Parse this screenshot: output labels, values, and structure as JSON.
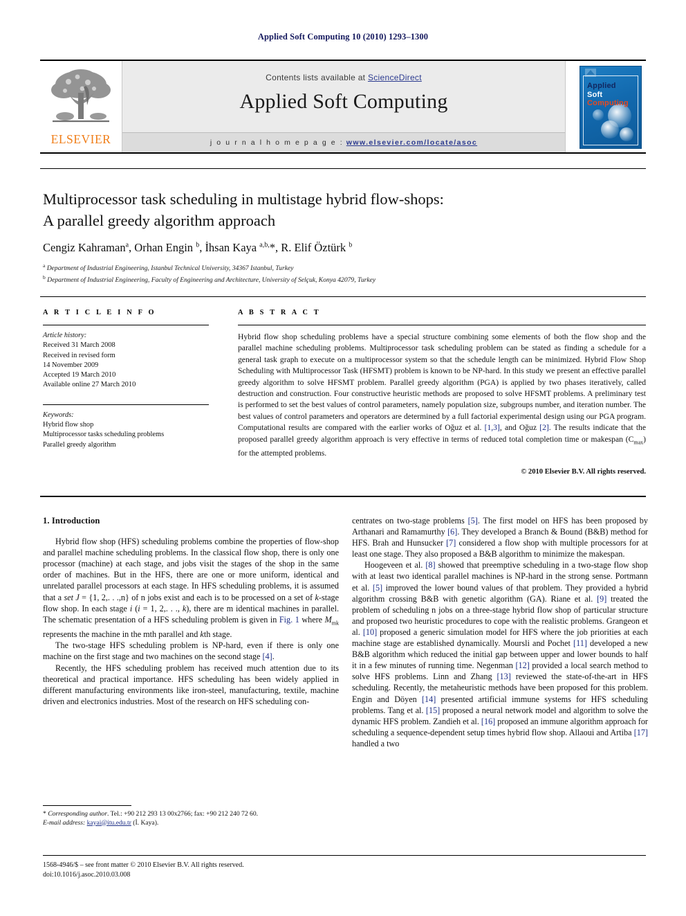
{
  "running_head": "Applied Soft Computing 10 (2010) 1293–1300",
  "masthead": {
    "contents_prefix": "Contents lists available at ",
    "sciencedirect": "ScienceDirect",
    "journal_name": "Applied Soft Computing",
    "homepage_label": "j o u r n a l    h o m e p a g e :",
    "homepage_url": "www.elsevier.com/locate/asoc",
    "publisher_wordmark": "ELSEVIER",
    "cover": {
      "line1": "Applied",
      "line2": "Soft",
      "line3": "Computing",
      "bg_color": "#1269ae",
      "line1_color": "#11265f",
      "line2_color": "#ffffff",
      "line3_color": "#e8491f"
    }
  },
  "article": {
    "title_line1": "Multiprocessor task scheduling in multistage hybrid flow-shops:",
    "title_line2": "A parallel greedy algorithm approach",
    "authors_html": "Cengiz Kahraman<sup>a</sup>, Orhan Engin <sup>b</sup>, İhsan Kaya <sup>a,b,</sup>*, R. Elif Öztürk <sup>b</sup>",
    "affiliation_a": "Department of Industrial Engineering, Istanbul Technical University, 34367 Istanbul, Turkey",
    "affiliation_b": "Department of Industrial Engineering, Faculty of Engineering and Architecture, University of Selçuk, Konya 42079, Turkey"
  },
  "info": {
    "heading": "A R T I C L E  I N F O",
    "history_label": "Article history:",
    "history": [
      "Received 31 March 2008",
      "Received in revised form",
      "14 November 2009",
      "Accepted 19 March 2010",
      "Available online 27 March 2010"
    ],
    "keywords_label": "Keywords:",
    "keywords": [
      "Hybrid flow shop",
      "Multiprocessor tasks scheduling problems",
      "Parallel greedy algorithm"
    ]
  },
  "abstract": {
    "heading": "A B S T R A C T",
    "text_html": "Hybrid flow shop scheduling problems have a special structure combining some elements of both the flow shop and the parallel machine scheduling problems. Multiprocessor task scheduling problem can be stated as finding a schedule for a general task graph to execute on a multiprocessor system so that the schedule length can be minimized. Hybrid Flow Shop Scheduling with Multiprocessor Task (HFSMT) problem is known to be NP-hard. In this study we present an effective parallel greedy algorithm to solve HFSMT problem. Parallel greedy algorithm (PGA) is applied by two phases iteratively, called destruction and construction. Four constructive heuristic methods are proposed to solve HFSMT problems. A preliminary test is performed to set the best values of control parameters, namely population size, subgroups number, and iteration number. The best values of control parameters and operators are determined by a full factorial experimental design using our PGA program. Computational results are compared with the earlier works of Oğuz et al. <span class=\"ref\">[1,3]</span>, and Oğuz <span class=\"ref\">[2]</span>. The results indicate that the proposed parallel greedy algorithm approach is very effective in terms of reduced total completion time or makespan (C<sub>max</sub>) for the attempted problems.",
    "copyright": "© 2010 Elsevier B.V. All rights reserved."
  },
  "body": {
    "section_number_title": "1.  Introduction",
    "left_paragraphs_html": [
      "Hybrid flow shop (HFS) scheduling problems combine the properties of flow-shop and parallel machine scheduling problems. In the classical flow shop, there is only one processor (machine) at each stage, and jobs visit the stages of the shop in the same order of machines. But in the HFS, there are one or more uniform, identical and unrelated parallel processors at each stage. In HFS scheduling problems, it is assumed that a <span class=\"ital\">set J</span> = {1, 2,. . .,n} of n jobs exist and each is to be processed on a set of <span class=\"ital\">k</span>-stage flow shop. In each stage <span class=\"ital\">i</span> (<span class=\"ital\">i</span> = 1, 2,. . ., <span class=\"ital\">k</span>), there are m identical machines in parallel. The schematic presentation of a HFS scheduling problem is given in <span class=\"ref\">Fig. 1</span> where <span class=\"ital\">M</span><sub>mk</sub> represents the machine in the mth parallel and <span class=\"ital\">k</span>th stage.",
      "The two-stage HFS scheduling problem is NP-hard, even if there is only one machine on the first stage and two machines on the second stage <span class=\"ref\">[4]</span>.",
      "Recently, the HFS scheduling problem has received much attention due to its theoretical and practical importance. HFS scheduling has been widely applied in different manufacturing environments like iron-steel, manufacturing, textile, machine driven and electronics industries. Most of the research on HFS scheduling con-"
    ],
    "right_paragraphs_html": [
      "centrates on two-stage problems <span class=\"ref\">[5]</span>. The first model on HFS has been proposed by Arthanari and Ramamurthy <span class=\"ref\">[6]</span>. They developed a Branch &amp; Bound (B&amp;B) method for HFS. Brah and Hunsucker <span class=\"ref\">[7]</span> considered a flow shop with multiple processors for at least one stage. They also proposed a B&amp;B algorithm to minimize the makespan.",
      "Hoogeveen et al. <span class=\"ref\">[8]</span> showed that preemptive scheduling in a two-stage flow shop with at least two identical parallel machines is NP-hard in the strong sense. Portmann et al. <span class=\"ref\">[5]</span> improved the lower bound values of that problem. They provided a hybrid algorithm crossing B&amp;B with genetic algorithm (GA). Riane et al. <span class=\"ref\">[9]</span> treated the problem of scheduling n jobs on a three-stage hybrid flow shop of particular structure and proposed two heuristic procedures to cope with the realistic problems. Grangeon et al. <span class=\"ref\">[10]</span> proposed a generic simulation model for HFS where the job priorities at each machine stage are established dynamically. Moursli and Pochet <span class=\"ref\">[11]</span> developed a new B&amp;B algorithm which reduced the initial gap between upper and lower bounds to half it in a few minutes of running time. Negenman <span class=\"ref\">[12]</span> provided a local search method to solve HFS problems. Linn and Zhang <span class=\"ref\">[13]</span> reviewed the state-of-the-art in HFS scheduling. Recently, the metaheuristic methods have been proposed for this problem. Engin and Döyen <span class=\"ref\">[14]</span> presented artificial immune systems for HFS scheduling problems. Tang et al. <span class=\"ref\">[15]</span> proposed a neural network model and algorithm to solve the dynamic HFS problem. Zandieh et al. <span class=\"ref\">[16]</span> proposed an immune algorithm approach for scheduling a sequence-dependent setup times hybrid flow shop. Allaoui and Artiba <span class=\"ref\">[17]</span> handled a two"
    ]
  },
  "footnote": {
    "corresponding_html": "* <span class=\"ital\">Corresponding author</span>. Tel.: +90 212 293 13 00x2766; fax: +90 212 240 72 60.",
    "email_label": "E-mail address:",
    "email": "kayai@itu.edu.tr",
    "email_owner": "(İ. Kaya)."
  },
  "footer": {
    "issn_line": "1568-4946/$ – see front matter © 2010 Elsevier B.V. All rights reserved.",
    "doi_line": "doi:10.1016/j.asoc.2010.03.008"
  }
}
